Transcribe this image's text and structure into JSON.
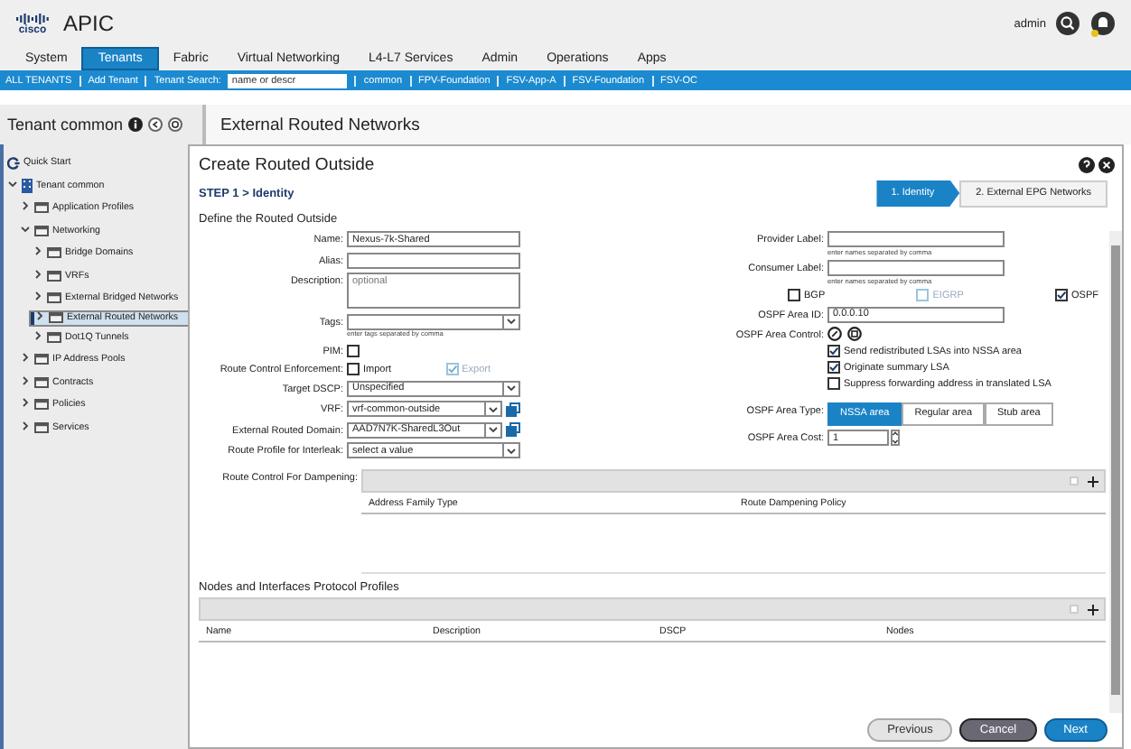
{
  "header": {
    "logo_text": "cisco",
    "app_name": "APIC",
    "user": "admin"
  },
  "tabs": [
    {
      "label": "System",
      "selected": false
    },
    {
      "label": "Tenants",
      "selected": true
    },
    {
      "label": "Fabric",
      "selected": false
    },
    {
      "label": "Virtual Networking",
      "selected": false
    },
    {
      "label": "L4-L7 Services",
      "selected": false
    },
    {
      "label": "Admin",
      "selected": false
    },
    {
      "label": "Operations",
      "selected": false
    },
    {
      "label": "Apps",
      "selected": false
    }
  ],
  "subnav": {
    "links": [
      "ALL TENANTS",
      "Add Tenant"
    ],
    "search_label": "Tenant Search:",
    "search_placeholder": "name or descr",
    "tenants": [
      "common",
      "FPV-Foundation",
      "FSV-App-A",
      "FSV-Foundation",
      "FSV-OC"
    ]
  },
  "sidebar": {
    "title": "Tenant common",
    "items": [
      {
        "kind": "quickstart",
        "label": "Quick Start",
        "selected": false
      },
      {
        "kind": "tenant",
        "label": "Tenant common",
        "selected": false,
        "expanded": true,
        "children": [
          {
            "kind": "folder",
            "label": "Application Profiles",
            "selected": false,
            "expanded": false
          },
          {
            "kind": "folder",
            "label": "Networking",
            "selected": false,
            "expanded": true,
            "children": [
              {
                "kind": "folder",
                "label": "Bridge Domains",
                "selected": false,
                "expanded": false
              },
              {
                "kind": "folder",
                "label": "VRFs",
                "selected": false,
                "expanded": false
              },
              {
                "kind": "folder",
                "label": "External Bridged Networks",
                "selected": false,
                "expanded": false
              },
              {
                "kind": "folder",
                "label": "External Routed Networks",
                "selected": true,
                "expanded": false
              },
              {
                "kind": "folder",
                "label": "Dot1Q Tunnels",
                "selected": false,
                "expanded": false
              }
            ]
          },
          {
            "kind": "folder",
            "label": "IP Address Pools",
            "selected": false,
            "expanded": false
          },
          {
            "kind": "folder",
            "label": "Contracts",
            "selected": false,
            "expanded": false
          },
          {
            "kind": "folder",
            "label": "Policies",
            "selected": false,
            "expanded": false
          },
          {
            "kind": "folder",
            "label": "Services",
            "selected": false,
            "expanded": false
          }
        ]
      }
    ]
  },
  "content_title": "External Routed Networks",
  "dialog": {
    "title": "Create Routed Outside",
    "step": "STEP 1 > Identity",
    "wizard_steps": [
      {
        "label": "1. Identity",
        "selected": true
      },
      {
        "label": "2. External EPG Networks",
        "selected": false
      }
    ],
    "section_title": "Define the Routed Outside",
    "left_fields": [
      {
        "kind": "text",
        "label": "Name:",
        "value": "Nexus-7k-Shared"
      },
      {
        "kind": "text",
        "label": "Alias:"
      },
      {
        "kind": "textarea",
        "label": "Description:",
        "placeholder": "optional"
      },
      {
        "kind": "select",
        "label": "Tags:",
        "hint": "enter tags separated by comma"
      },
      {
        "kind": "checks",
        "label": "PIM:",
        "options": [
          {
            "checked": false,
            "disabled": false
          }
        ]
      },
      {
        "kind": "checks",
        "label": "Route Control Enforcement:",
        "options": [
          {
            "label": "Import",
            "checked": false,
            "disabled": false
          },
          {
            "label": "Export",
            "checked": true,
            "disabled": true
          }
        ]
      },
      {
        "kind": "select",
        "label": "Target DSCP:",
        "value": "Unspecified"
      },
      {
        "kind": "select",
        "label": "VRF:",
        "value": "vrf-common-outside",
        "link": true
      },
      {
        "kind": "select",
        "label": "External Routed Domain:",
        "value": "AAD7N7K-SharedL3Out",
        "link": true
      },
      {
        "kind": "select",
        "label": "Route Profile for Interleak:",
        "value": "select a value"
      }
    ],
    "right_fields": [
      {
        "kind": "text",
        "label": "Provider Label:",
        "hint": "enter names separated by comma"
      },
      {
        "kind": "text",
        "label": "Consumer Label:",
        "hint": "enter names separated by comma"
      },
      {
        "kind": "checks",
        "options": [
          {
            "label": "BGP",
            "checked": false,
            "disabled": false
          },
          {
            "label": "EIGRP",
            "checked": false,
            "disabled": true
          },
          {
            "label": "OSPF",
            "checked": true,
            "disabled": false
          }
        ]
      },
      {
        "kind": "text",
        "label": "OSPF Area ID:",
        "value": "0.0.0.10"
      },
      {
        "kind": "area_control",
        "label": "OSPF Area Control:",
        "options": [
          {
            "label": "Send redistributed LSAs into NSSA area",
            "checked": true,
            "disabled": false
          },
          {
            "label": "Originate summary LSA",
            "checked": true,
            "disabled": false
          },
          {
            "label": "Suppress forwarding address in translated LSA",
            "checked": false,
            "disabled": false
          }
        ]
      },
      {
        "kind": "segmented",
        "label": "OSPF Area Type:",
        "options": [
          {
            "label": "NSSA area",
            "selected": true
          },
          {
            "label": "Regular area",
            "selected": false
          },
          {
            "label": "Stub area",
            "selected": false
          }
        ]
      },
      {
        "kind": "spinner",
        "label": "OSPF Area Cost:",
        "value": "1"
      }
    ],
    "dampening": {
      "label": "Route Control For Dampening:",
      "columns": [
        "Address Family Type",
        "Route Dampening Policy"
      ]
    },
    "nodes": {
      "title": "Nodes and Interfaces Protocol Profiles",
      "columns": [
        "Name",
        "Description",
        "DSCP",
        "Nodes"
      ]
    },
    "buttons": [
      {
        "kind": "secondary",
        "label": "Previous"
      },
      {
        "kind": "dark",
        "label": "Cancel"
      },
      {
        "kind": "primary",
        "label": "Next"
      }
    ]
  }
}
